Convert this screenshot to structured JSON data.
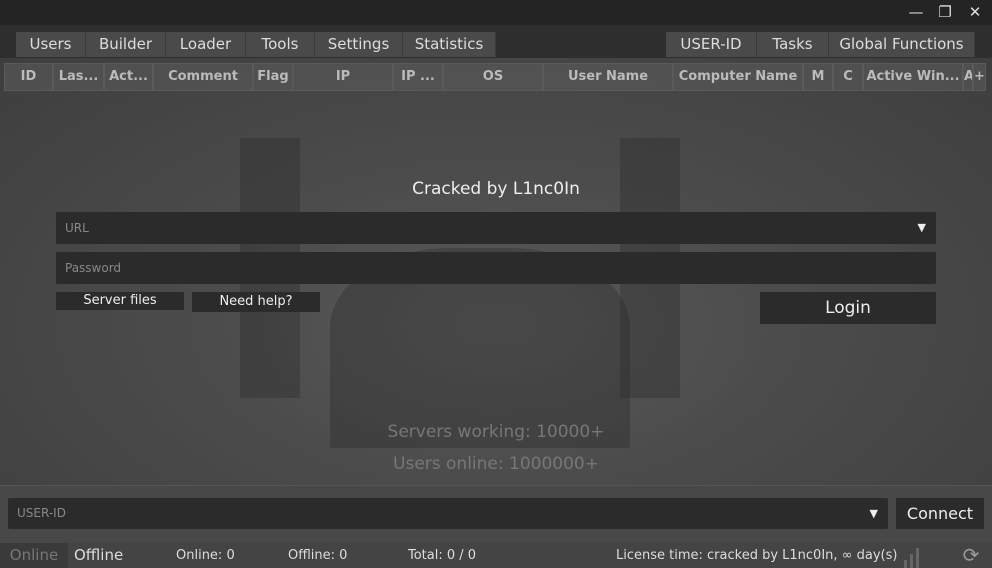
{
  "window": {
    "minimize": "—",
    "restore": "❐",
    "close": "✕"
  },
  "tabs_left": [
    "Users",
    "Builder",
    "Loader",
    "Tools",
    "Settings",
    "Statistics"
  ],
  "tabs_right": [
    "USER-ID",
    "Tasks",
    "Global Functions"
  ],
  "columns": [
    "ID",
    "Las...",
    "Act...",
    "Comment",
    "Flag",
    "IP",
    "IP ...",
    "OS",
    "User Name",
    "Computer Name",
    "M",
    "C",
    "Active Win...",
    "A",
    "+"
  ],
  "login": {
    "title": "Cracked by L1nc0In",
    "url_placeholder": "URL",
    "password_placeholder": "Password",
    "server_files": "Server files",
    "need_help": "Need help?",
    "login": "Login"
  },
  "stats": {
    "servers": "Servers working: 10000+",
    "users": "Users online: 1000000+"
  },
  "connect": {
    "userid_placeholder": "USER-ID",
    "connect": "Connect"
  },
  "status": {
    "online_tab": "Online",
    "offline_tab": "Offline",
    "online": "Online: 0",
    "offline": "Offline: 0",
    "total": "Total: 0 / 0",
    "license": "License time: cracked by L1nc0In, ∞ day(s)",
    "refresh": "⟳"
  }
}
